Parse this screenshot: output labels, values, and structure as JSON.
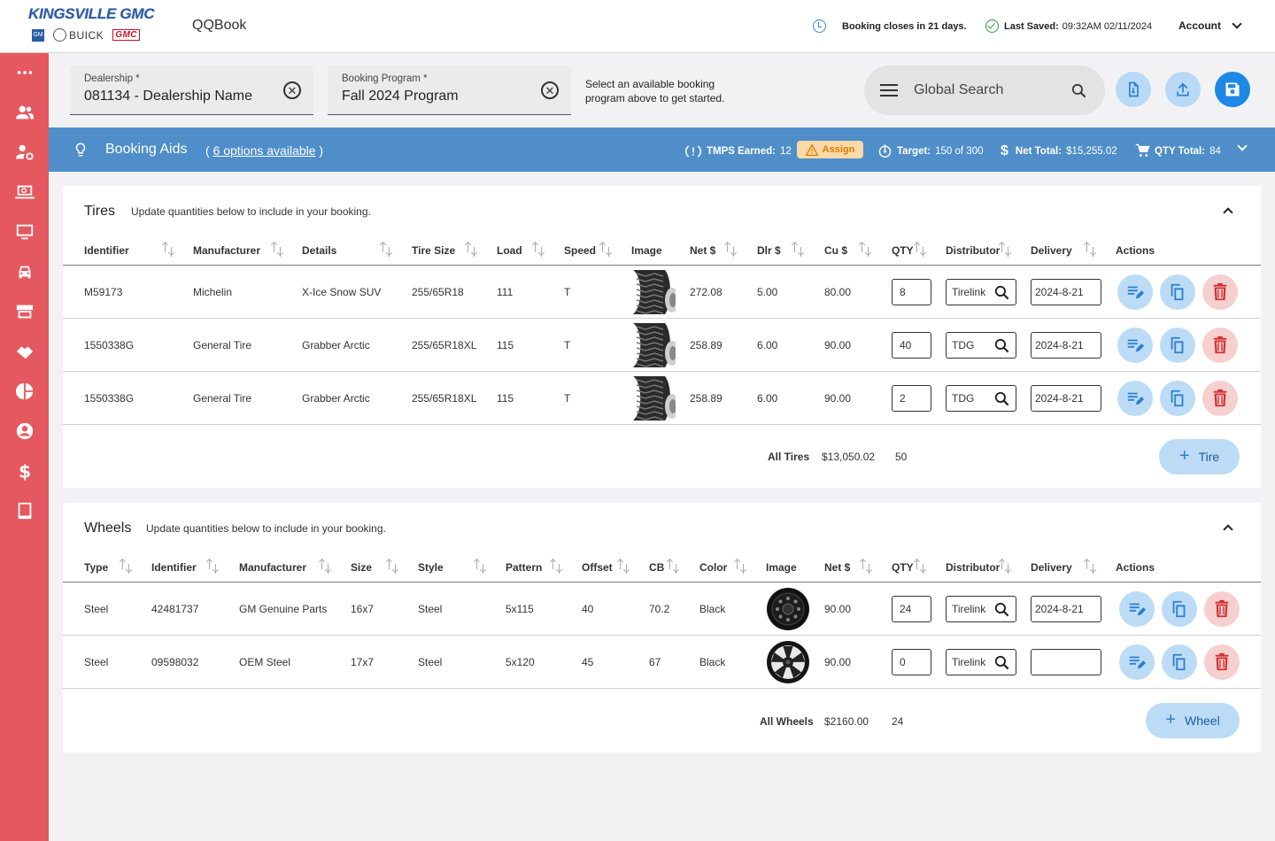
{
  "header": {
    "brand": "KINGSVILLE GMC",
    "logos": {
      "gm": "GM",
      "buick": "BUICK",
      "gmc": "GMC"
    },
    "app_name": "QQBook",
    "booking_closes": "Booking closes in 21 days.",
    "last_saved_label": "Last Saved:",
    "last_saved_value": "09:32AM 02/11/2024",
    "account": "Account"
  },
  "sidebar": {
    "items": [
      "more-icon",
      "users-icon",
      "user-settings-icon",
      "laptop-search-icon",
      "monitor-icon",
      "car-icon",
      "store-icon",
      "handshake-icon",
      "pie-chart-icon",
      "account-circle-icon",
      "dollar-icon",
      "book-icon"
    ]
  },
  "filters": {
    "dealership_label": "Dealership *",
    "dealership_value": "081134 - Dealership Name",
    "program_label": "Booking Program *",
    "program_value": "Fall 2024 Program",
    "hint": "Select an available booking program above to get started.",
    "search_placeholder": "Global Search"
  },
  "booking_aids": {
    "title": "Booking Aids",
    "options_prefix": "( ",
    "options_link": "6 options available",
    "options_suffix": " )",
    "tmps_label": "TMPS Earned:",
    "tmps_value": "12",
    "assign": "Assign",
    "target_label": "Target:",
    "target_value": "150 of 300",
    "net_label": "Net Total:",
    "net_value": "$15,255.02",
    "qty_label": "QTY Total:",
    "qty_value": "84"
  },
  "tires": {
    "title": "Tires",
    "subtitle": "Update quantities below to include in your booking.",
    "columns": [
      "Identifier",
      "Manufacturer",
      "Details",
      "Tire Size",
      "Load",
      "Speed",
      "Image",
      "Net $",
      "Dlr $",
      "Cu $",
      "QTY",
      "Distributor",
      "Delivery",
      "Actions"
    ],
    "rows": [
      {
        "identifier": "M59173",
        "manufacturer": "Michelin",
        "details": "X-Ice Snow SUV",
        "size": "255/65R18",
        "load": "111",
        "speed": "T",
        "net": "272.08",
        "dlr": "5.00",
        "cu": "80.00",
        "qty": "8",
        "distributor": "Tirelink",
        "delivery": "2024-8-21"
      },
      {
        "identifier": "1550338G",
        "manufacturer": "General Tire",
        "details": "Grabber Arctic",
        "size": "255/65R18XL",
        "load": "115",
        "speed": "T",
        "net": "258.89",
        "dlr": "6.00",
        "cu": "90.00",
        "qty": "40",
        "distributor": "TDG",
        "delivery": "2024-8-21"
      },
      {
        "identifier": "1550338G",
        "manufacturer": "General Tire",
        "details": "Grabber Arctic",
        "size": "255/65R18XL",
        "load": "115",
        "speed": "T",
        "net": "258.89",
        "dlr": "6.00",
        "cu": "90.00",
        "qty": "2",
        "distributor": "TDG",
        "delivery": "2024-8-21"
      }
    ],
    "total_label": "All Tires",
    "total_net": "$13,050.02",
    "total_qty": "50",
    "add_label": "Tire"
  },
  "wheels": {
    "title": "Wheels",
    "subtitle": "Update quantities below to include in your booking.",
    "columns": [
      "Type",
      "Identifier",
      "Manufacturer",
      "Size",
      "Style",
      "Pattern",
      "Offset",
      "CB",
      "Color",
      "Image",
      "Net $",
      "QTY",
      "Distributor",
      "Delivery",
      "Actions"
    ],
    "rows": [
      {
        "type": "Steel",
        "identifier": "42481737",
        "manufacturer": "GM Genuine Parts",
        "size": "16x7",
        "style": "Steel",
        "pattern": "5x115",
        "offset": "40",
        "cb": "70.2",
        "color": "Black",
        "net": "90.00",
        "qty": "24",
        "distributor": "Tirelink",
        "delivery": "2024-8-21"
      },
      {
        "type": "Steel",
        "identifier": "09598032",
        "manufacturer": "OEM Steel",
        "size": "17x7",
        "style": "Steel",
        "pattern": "5x120",
        "offset": "45",
        "cb": "67",
        "color": "Black",
        "net": "90.00",
        "qty": "0",
        "distributor": "Tirelink",
        "delivery": ""
      }
    ],
    "total_label": "All Wheels",
    "total_net": "$2160.00",
    "total_qty": "24",
    "add_label": "Wheel"
  },
  "colors": {
    "sidebar": "#e5585f",
    "aids_bar": "#4f8ec9",
    "primary": "#1e88e5",
    "assign_bg": "#fcd9a8"
  }
}
